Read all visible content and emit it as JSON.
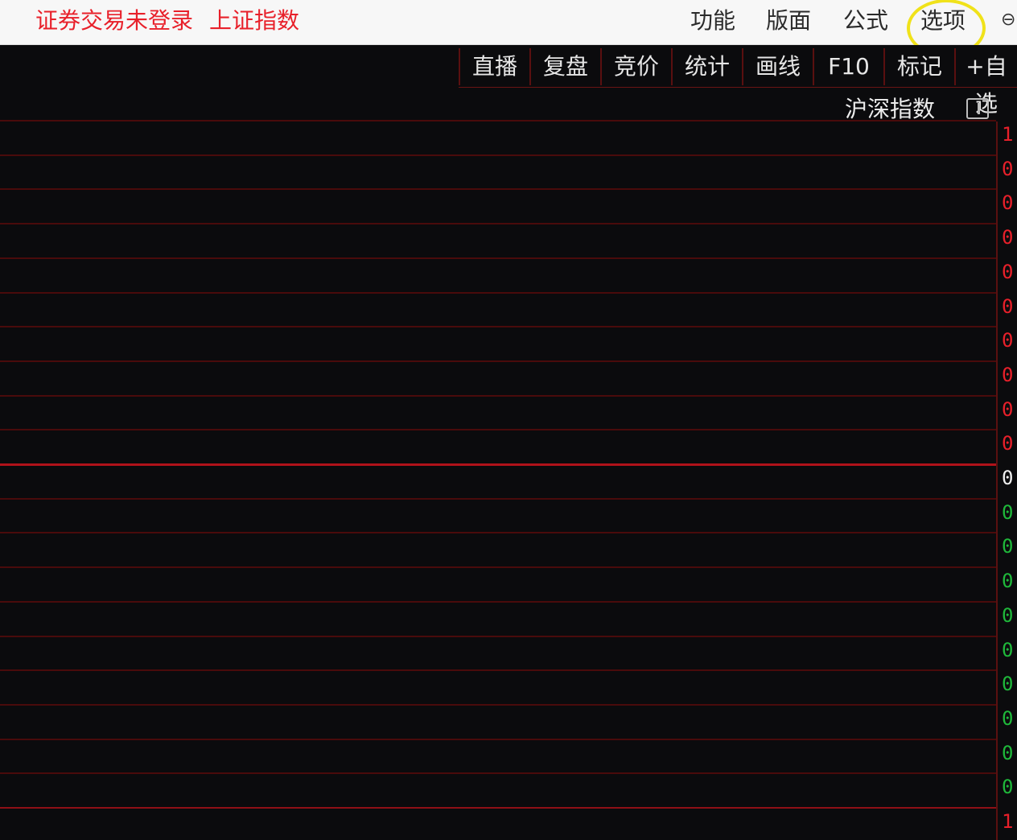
{
  "top_bar": {
    "login_status": "证券交易未登录",
    "index_name": "上证指数",
    "menu": [
      "功能",
      "版面",
      "公式",
      "选项"
    ]
  },
  "toolbar": {
    "buttons": [
      "直播",
      "复盘",
      "竞价",
      "统计",
      "画线",
      "F10",
      "标记",
      "+自选"
    ]
  },
  "panel": {
    "index_selector": "沪深指数"
  },
  "right_axis": {
    "labels": [
      "1",
      "0",
      "0",
      "0",
      "0",
      "0",
      "0",
      "0",
      "0",
      "0",
      "0",
      "0",
      "0",
      "0",
      "0",
      "0",
      "0",
      "0",
      "0",
      "0",
      "1"
    ]
  },
  "colors": {
    "up": "#e8202a",
    "down": "#1fb83a",
    "highlight": "#f0e21a"
  }
}
